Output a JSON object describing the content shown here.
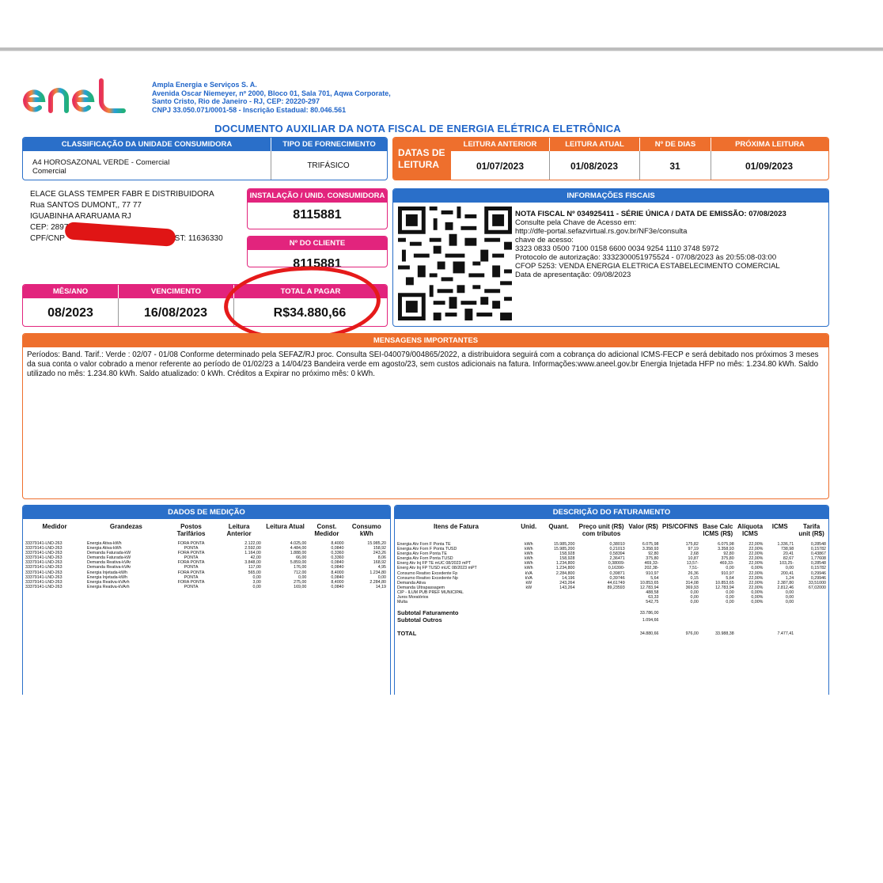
{
  "company": {
    "name": "Ampla Energia e Serviços S. A.",
    "address1": "Avenida Oscar Niemeyer, nº 2000, Bloco 01, Sala 701, Aqwa Corporate,",
    "address2": "Santo Cristo, Rio de Janeiro - RJ, CEP: 20220-297",
    "cnpj": "CNPJ 33.050.071/0001-58 - Inscrição Estadual: 80.046.561"
  },
  "doc_title": "DOCUMENTO AUXILIAR DA NOTA FISCAL DE ENERGIA ELÉTRICA ELETRÔNICA",
  "classificacao": {
    "label": "CLASSIFICAÇÃO DA UNIDADE CONSUMIDORA",
    "value1": "A4 HOROSAZONAL VERDE - Comercial",
    "value2": "Comercial"
  },
  "fornecimento": {
    "label": "TIPO DE FORNECIMENTO",
    "value": "TRIFÁSICO"
  },
  "leitura": {
    "datas_label1": "DATAS DE",
    "datas_label2": "LEITURA",
    "anterior_label": "LEITURA ANTERIOR",
    "anterior": "01/07/2023",
    "atual_label": "LEITURA ATUAL",
    "atual": "01/08/2023",
    "dias_label": "Nº DE DIAS",
    "dias": "31",
    "proxima_label": "PRÓXIMA LEITURA",
    "proxima": "01/09/2023"
  },
  "cliente": {
    "name": "ELACE GLASS TEMPER FABR E DISTRIBUIDORA",
    "street": "Rua SANTOS DUMONT,, 77 77",
    "city": "IGUABINHA ARARUAMA RJ",
    "cep": "CEP: 28970-001",
    "cpf_label": "CPF/CNP",
    "est": "EST: 11636330"
  },
  "instalacao": {
    "label": "INSTALAÇÃO / UNID. CONSUMIDORA",
    "value": "8115881"
  },
  "num_cliente": {
    "label": "Nº DO CLIENTE",
    "value": "8115881"
  },
  "pagamento": {
    "mes_label": "MÊS/ANO",
    "mes": "08/2023",
    "venc_label": "VENCIMENTO",
    "venc": "16/08/2023",
    "total_label": "TOTAL A PAGAR",
    "total": "R$34.880,66"
  },
  "fiscal": {
    "label": "INFORMAÇÕES FISCAIS",
    "l1": "NOTA FISCAL Nº 034925411 - SÉRIE ÚNICA / DATA DE EMISSÃO: 07/08/2023",
    "l2": "Consulte pela Chave de Acesso em:",
    "l3": "http://dfe-portal.sefazvirtual.rs.gov.br/NF3e/consulta",
    "l4": "chave de acesso:",
    "l5": "3323 0833 0500 7100 0158 6600 0034 9254 1110 3748 5972",
    "l6": "Protocolo de autorização: 3332300051975524 - 07/08/2023 às 20:55:08-03:00",
    "l7": "CFOP 5253: VENDA ENERGIA ELETRICA ESTABELECIMENTO COMERCIAL",
    "l8": "Data de apresentação: 09/08/2023"
  },
  "mensagens": {
    "label": "MENSAGENS IMPORTANTES",
    "text": "Períodos: Band. Tarif.: Verde : 02/07 - 01/08 Conforme determinado pela SEFAZ/RJ proc. Consulta SEI-040079/004865/2022, a distribuidora seguirá com a cobrança do adicional ICMS-FECP e será debitado nos próximos 3 meses da sua conta o valor cobrado a menor referente ao período de 01/02/23 a 14/04/23 Bandeira verde em agosto/23, sem custos adicionais na fatura. Informações:www.aneel.gov.br Energia Injetada HFP no mês: 1.234.80 kWh. Saldo utilizado no mês: 1.234.80 kWh. Saldo atualizado: 0 kWh. Créditos a Expirar no próximo mês: 0 kWh."
  },
  "medicao": {
    "label": "DADOS DE MEDIÇÃO",
    "headers": [
      "Medidor",
      "Grandezas",
      "Postos Tarifários",
      "Leitura Anterior",
      "Leitura Atual",
      "Const. Medidor",
      "Consumo kWh"
    ],
    "rows": [
      [
        "33379141-LND-263",
        "Energia Ativa-kWh",
        "FORA PONTA",
        "2.122,00",
        "4.025,00",
        "8,4000",
        "15.985,20"
      ],
      [
        "33379141-LND-263",
        "Energia Ativa-kWh",
        "PONTA",
        "2.592,00",
        "4.484,00",
        "0,0840",
        "158,92"
      ],
      [
        "33379141-LND-263",
        "Demanda Faturada-kW",
        "FORA PONTA",
        "1.164,00",
        "1.888,00",
        "0,3360",
        "243,26"
      ],
      [
        "33379141-LND-263",
        "Demanda Faturada-kW",
        "PONTA",
        "42,00",
        "66,00",
        "0,3360",
        "8,06"
      ],
      [
        "33379141-LND-263",
        "Demanda Reativa-kVAr",
        "FORA PONTA",
        "3.848,00",
        "5.859,00",
        "0,0840",
        "168,92"
      ],
      [
        "33379141-LND-263",
        "Demanda Reativa-kVAr",
        "PONTA",
        "117,00",
        "176,00",
        "0,0840",
        "4,95"
      ],
      [
        "33379141-LND-263",
        "Energia Injetada-kWh",
        "FORA PONTA",
        "565,00",
        "712,00",
        "8,4000",
        "1.234,80"
      ],
      [
        "33379141-LND-263",
        "Energia Injetada-kWh",
        "PONTA",
        "0,00",
        "0,00",
        "0,0840",
        "0,00"
      ],
      [
        "33379141-LND-263",
        "Energia Reativa-kVArh",
        "FORA PONTA",
        "3,00",
        "275,00",
        "8,4000",
        "2.284,80"
      ],
      [
        "33379141-LND-263",
        "Energia Reativa-kVArh",
        "PONTA",
        "0,00",
        "169,00",
        "0,0840",
        "14,19"
      ]
    ]
  },
  "faturamento": {
    "label": "DESCRIÇÃO DO FATURAMENTO",
    "headers": [
      "Itens de Fatura",
      "Unid.",
      "Quant.",
      "Preço unit (R$) com tributos",
      "Valor (R$)",
      "PIS/COFINS",
      "Base Calc ICMS (R$)",
      "Alíquota ICMS",
      "ICMS",
      "Tarifa unit (R$)"
    ],
    "rows": [
      [
        "Energia Atv Forn F Ponta TE",
        "kWh",
        "15.985,200",
        "0,38010",
        "6.075,98",
        "175,82",
        "6.075,98",
        "22,00%",
        "1.336,71",
        "0,28548"
      ],
      [
        "Energia Atv Forn F Ponta TUSD",
        "kWh",
        "15.985,200",
        "0,21013",
        "3.358,93",
        "97,19",
        "3.358,93",
        "22,00%",
        "738,98",
        "0,15782"
      ],
      [
        "Energia Atv Forn Ponta TE",
        "kWh",
        "158,928",
        "0,58394",
        "92,80",
        "2,68",
        "92,80",
        "22,00%",
        "20,41",
        "0,43867"
      ],
      [
        "Energia Atv Forn Ponta TUSD",
        "kWh",
        "158,928",
        "2,36471",
        "375,80",
        "10,87",
        "375,80",
        "22,00%",
        "82,67",
        "1,77608"
      ],
      [
        "Energ Atv Inj FP TE mUC 08/2023 mPT",
        "kWh",
        "1.234,800",
        "0,38009-",
        "469,33-",
        "13,57-",
        "469,33-",
        "22,00%",
        "103,25-",
        "0,28548"
      ],
      [
        "Energ Atv Inj FP TUSD mUC 08/2023 mPT",
        "kWh",
        "1.234,800",
        "0,16390-",
        "202,38-",
        "7,51-",
        "0,00",
        "0,00%",
        "0,00",
        "0,15782"
      ],
      [
        "Consumo Reativo Excedente Fp",
        "kVA",
        "2.284,800",
        "0,39871",
        "910,97",
        "26,36",
        "910,97",
        "22,00%",
        "200,41",
        "0,29946"
      ],
      [
        "Consumo Reativo Excedente Np",
        "kVA",
        "14,196",
        "0,39746",
        "5,64",
        "0,15",
        "5,64",
        "22,00%",
        "1,24",
        "0,29946"
      ],
      [
        "Demanda Ativa",
        "kW",
        "243,264",
        "44,61749",
        "10.853,65",
        "314,08",
        "10.853,65",
        "22,00%",
        "2.387,80",
        "33,51000"
      ],
      [
        "Demanda Ultrapassagem",
        "kW",
        "143,264",
        "89,23593",
        "12.783,94",
        "369,93",
        "12.783,94",
        "22,00%",
        "2.812,46",
        "67,02000"
      ],
      [
        "CIP - ILUM PUB PREF MUNICIPAL",
        "",
        "",
        "",
        "488,58",
        "0,00",
        "0,00",
        "0,00%",
        "0,00",
        ""
      ],
      [
        "Juros Moratórios",
        "",
        "",
        "",
        "63,33",
        "0,00",
        "0,00",
        "0,00%",
        "0,00",
        ""
      ],
      [
        "Multa",
        "",
        "",
        "",
        "542,75",
        "0,00",
        "0,00",
        "0,00%",
        "0,00",
        ""
      ]
    ],
    "subtotal_fat_label": "Subtotal Faturamento",
    "subtotal_fat": "33.786,00",
    "subtotal_out_label": "Subtotal Outros",
    "subtotal_out": "1.094,66",
    "total_label": "TOTAL",
    "total": "34.880,66",
    "total_pis": "976,00",
    "total_base": "33.988,38",
    "total_icms": "7.477,41"
  }
}
